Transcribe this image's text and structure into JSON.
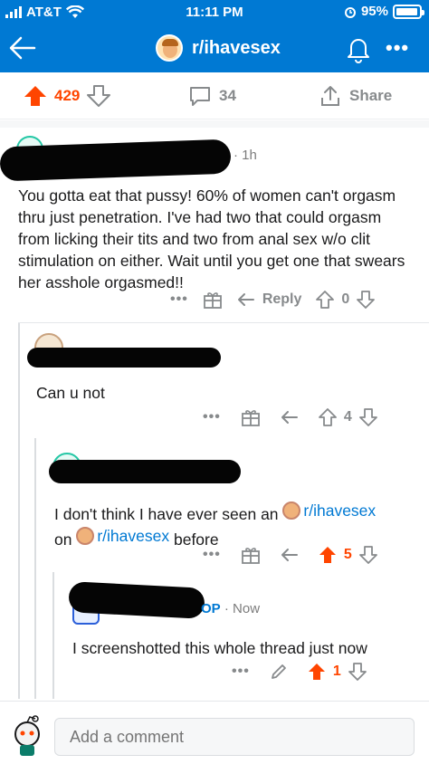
{
  "status_bar": {
    "carrier": "AT&T",
    "time": "11:11 PM",
    "battery": "95%",
    "battery_level": 0.95
  },
  "nav": {
    "subreddit": "r/ihavesex",
    "more": "•••"
  },
  "post_actions": {
    "upvotes": "429",
    "comments": "34",
    "share": "Share"
  },
  "comments": [
    {
      "time": "· 1h",
      "text": "You gotta eat that pussy! 60% of women can't orgasm thru just penetration. I've had two that could orgasm from licking their tits and two from anal sex w/o clit stimulation on either. Wait until you get one that swears her asshole orgasmed!!",
      "reply": "Reply",
      "votes": "0",
      "more": "•••"
    },
    {
      "text": "Can u not",
      "votes": "4",
      "more": "•••"
    },
    {
      "text_before": "I don't think I have ever seen an",
      "sub1": "r/ihavesex",
      "text_on": "on",
      "sub2": "r/ihavesex",
      "text_after": "before",
      "votes": "5",
      "more": "•••"
    },
    {
      "op": "OP",
      "time": "· Now",
      "text": "I screenshotted this whole thread just now",
      "votes": "1",
      "more": "•••"
    }
  ],
  "composer": {
    "placeholder": "Add a comment"
  },
  "colors": {
    "brand_blue": "#0079d3",
    "upvote_orange": "#ff4500",
    "meta_gray": "#878a8c"
  }
}
